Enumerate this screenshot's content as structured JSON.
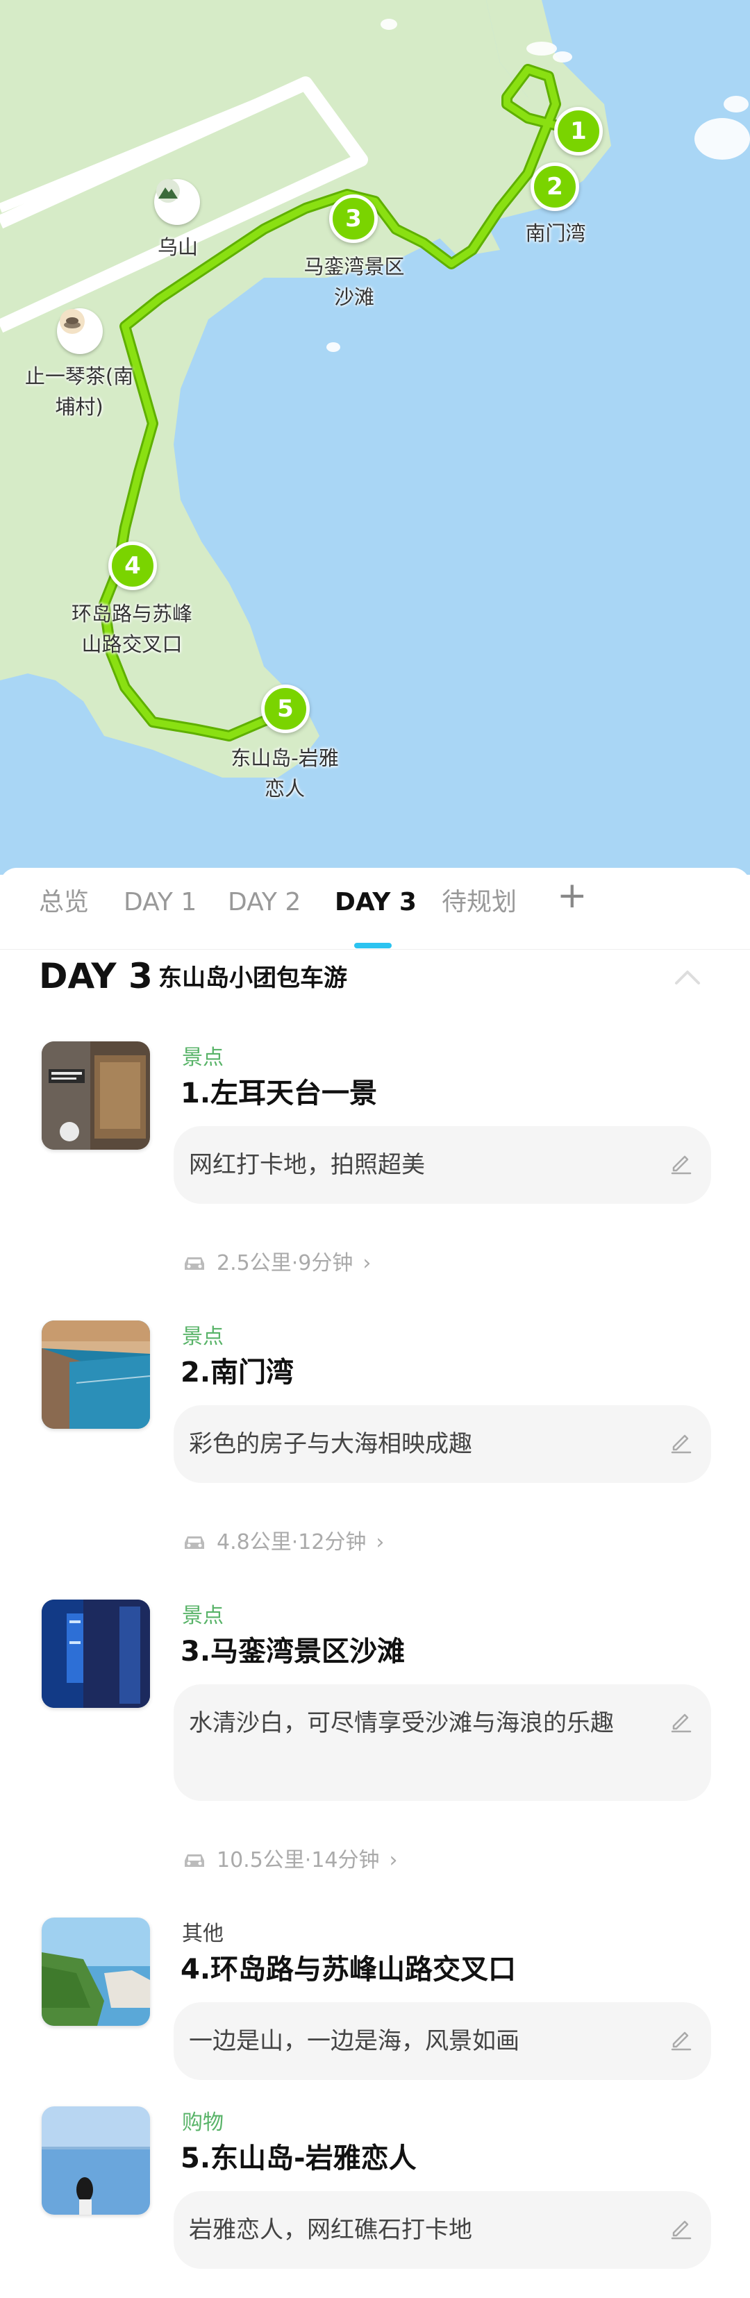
{
  "map": {
    "markers": [
      {
        "num": "1"
      },
      {
        "num": "2",
        "label": "南门湾"
      },
      {
        "num": "3",
        "label_line1": "马銮湾景区",
        "label_line2": "沙滩"
      },
      {
        "num": "4",
        "label_line1": "环岛路与苏峰",
        "label_line2": "山路交叉口"
      },
      {
        "num": "5",
        "label_line1": "东山岛-岩雅",
        "label_line2": "恋人"
      }
    ],
    "pois": [
      {
        "label": "乌山",
        "icon": "mountain-icon"
      },
      {
        "label_line1": "止一琴茶(南",
        "label_line2": "埔村)",
        "icon": "teacup-icon"
      }
    ],
    "colors": {
      "water": "#a9d6f5",
      "land": "#d6ebc7",
      "route": "#7ad400",
      "marker": "#7ad400"
    }
  },
  "tabs": {
    "items": [
      "总览",
      "DAY 1",
      "DAY 2",
      "DAY 3",
      "待规划"
    ],
    "add": "+",
    "active_index": 3,
    "accent": "#2cc3f0"
  },
  "day": {
    "title": "DAY 3",
    "subtitle": "东山岛小团包车游"
  },
  "stops": [
    {
      "category": "景点",
      "title": "1.左耳天台一景",
      "note": "网红打卡地，拍照超美"
    },
    {
      "category": "景点",
      "title": "2.南门湾",
      "note": "彩色的房子与大海相映成趣"
    },
    {
      "category": "景点",
      "title": "3.马銮湾景区沙滩",
      "note": "水清沙白，可尽情享受沙滩与海浪的乐趣"
    },
    {
      "category": "其他",
      "title": "4.环岛路与苏峰山路交叉口",
      "note": "一边是山，一边是海，风景如画"
    },
    {
      "category": "购物",
      "title": "5.东山岛-岩雅恋人",
      "note": "岩雅恋人，网红礁石打卡地"
    }
  ],
  "transits": [
    {
      "text": "2.5公里·9分钟"
    },
    {
      "text": "4.8公里·12分钟"
    },
    {
      "text": "10.5公里·14分钟"
    }
  ],
  "colors": {
    "category_green": "#58b368",
    "note_bg": "#f5f5f5"
  }
}
